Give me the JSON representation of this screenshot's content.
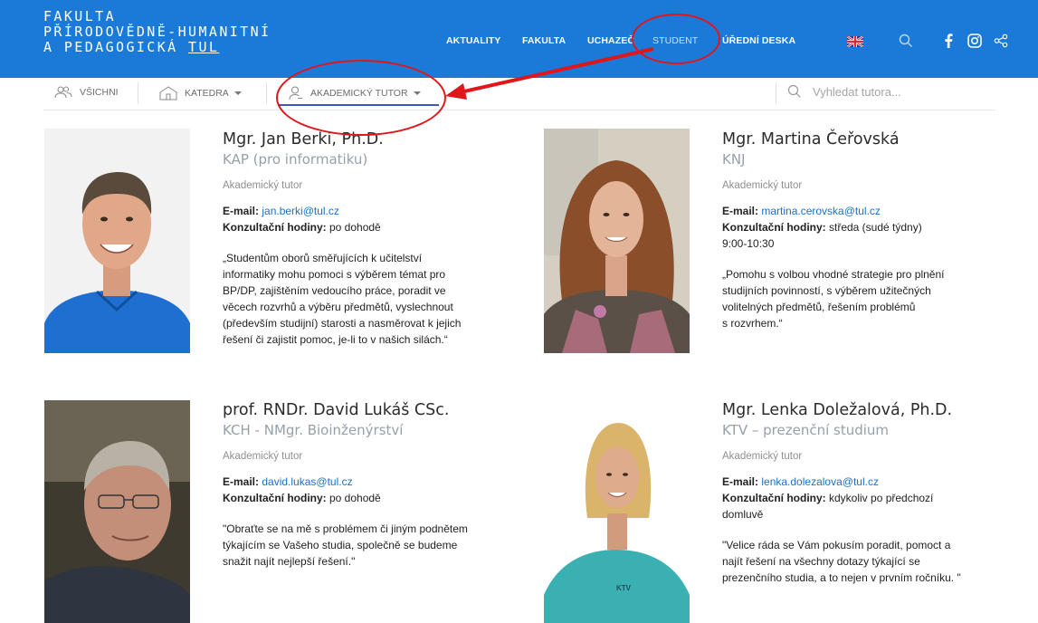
{
  "header": {
    "logo_lines": [
      "FAKULTA",
      "PŘÍRODOVĚDNĚ-HUMANITNÍ",
      "A PEDAGOGICKÁ"
    ],
    "logo_tul": "TUL",
    "nav": [
      "AKTUALITY",
      "FAKULTA",
      "UCHAZEČ",
      "STUDENT",
      "ÚŘEDNÍ DESKA"
    ],
    "active_nav": "STUDENT",
    "brand_color": "#1b79d8",
    "icons": [
      "uk-flag-icon",
      "search-icon",
      "facebook-icon",
      "instagram-icon",
      "share-icon"
    ]
  },
  "filters": {
    "all": "VŠICHNI",
    "department": "KATEDRA",
    "tutor": "AKADEMICKÝ TUTOR",
    "search_placeholder": "Vyhledat tutora..."
  },
  "annotation_color": "#e0161b",
  "tutors": [
    {
      "name": "Mgr. Jan Berki, Ph.D.",
      "dept": "KAP (pro informatiku)",
      "role": "Akademický tutor",
      "email_label": "E-mail:",
      "email": "jan.berki@tul.cz",
      "hours_label": "Konzultační hodiny:",
      "hours": "po dohodě",
      "quote_lines": [
        "„Studentům oborů směřujících k učitelství",
        "informatiky mohu pomoci s výběrem témat pro",
        "BP/DP, zajištěním vedoucího práce, poradit ve",
        "věcech rozvrhů a výběru předmětů, vyslechnout",
        "(především studijní) starosti a nasměrovat k jejich",
        "řešení či zajistit pomoc, je-li to v našich silách.“"
      ]
    },
    {
      "name": "Mgr. Martina Čeřovská",
      "dept": "KNJ",
      "role": "Akademický tutor",
      "email_label": "E-mail:",
      "email": "martina.cerovska@tul.cz",
      "hours_label": "Konzultační hodiny:",
      "hours": "středa (sudé týdny)",
      "hours_line2": "9:00-10:30",
      "quote_lines": [
        "„Pomohu s volbou vhodné strategie pro plnění",
        "studijních povinností, s výběrem užitečných",
        "volitelných předmětů, řešením problémů",
        "s rozvrhem.“"
      ]
    },
    {
      "name": "prof. RNDr. David Lukáš CSc.",
      "dept": "KCH - NMgr. Bioinženýrství",
      "role": "Akademický tutor",
      "email_label": "E-mail:",
      "email": "david.lukas@tul.cz",
      "hours_label": "Konzultační hodiny:",
      "hours": "po dohodě",
      "quote_lines": [
        "\"Obraťte se na mě s problémem či jiným podnětem",
        "týkajícím se Vašeho studia, společně se budeme",
        "snažit najít nejlepší řešení.\""
      ]
    },
    {
      "name": "Mgr. Lenka Doležalová, Ph.D.",
      "dept": "KTV – prezenční studium",
      "role": "Akademický tutor",
      "email_label": "E-mail:",
      "email": "lenka.dolezalova@tul.cz",
      "hours_label": "Konzultační hodiny:",
      "hours": "kdykoliv po předchozí",
      "hours_line2": "domluvě",
      "quote_lines": [
        "\"Velice ráda se Vám pokusím poradit, pomoct a",
        "najít řešení na všechny dotazy týkající se",
        "prezenčního studia, a to nejen v prvním ročníku. \""
      ],
      "shirt_text": "KTV"
    }
  ]
}
